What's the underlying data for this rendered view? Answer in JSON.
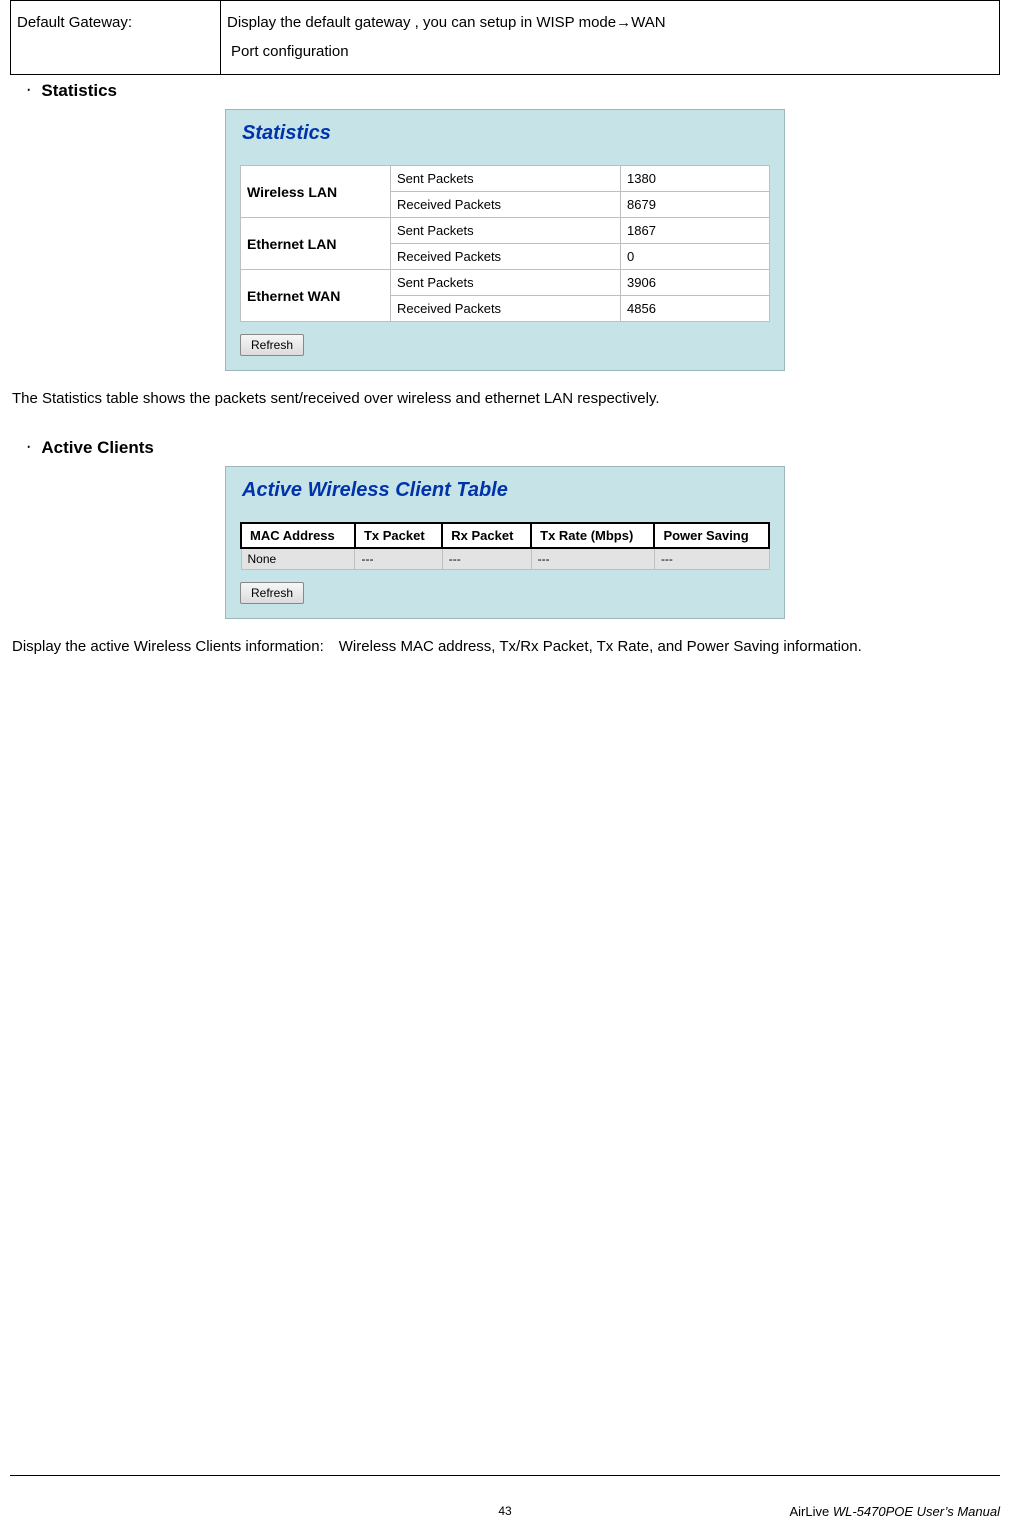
{
  "info_table": {
    "label": "Default Gateway:",
    "desc_line1": "Display the default gateway , you can setup in WISP mode→WAN",
    "desc_line2": "Port configuration"
  },
  "sections": {
    "statistics": {
      "bullet": "‧",
      "title": "Statistics",
      "panel_title": "Statistics",
      "rows": [
        {
          "iface": "Wireless LAN",
          "metric": "Sent Packets",
          "value": "1380"
        },
        {
          "iface": "",
          "metric": "Received Packets",
          "value": "8679"
        },
        {
          "iface": "Ethernet LAN",
          "metric": "Sent Packets",
          "value": "1867"
        },
        {
          "iface": "",
          "metric": "Received Packets",
          "value": "0"
        },
        {
          "iface": "Ethernet WAN",
          "metric": "Sent Packets",
          "value": "3906"
        },
        {
          "iface": "",
          "metric": "Received Packets",
          "value": "4856"
        }
      ],
      "refresh": "Refresh",
      "body": "The Statistics table shows the packets sent/received over wireless and ethernet LAN respectively."
    },
    "active_clients": {
      "bullet": "‧",
      "title": "Active Clients",
      "panel_title": "Active Wireless Client Table",
      "headers": [
        "MAC Address",
        "Tx Packet",
        "Rx Packet",
        "Tx Rate (Mbps)",
        "Power Saving"
      ],
      "row": [
        "None",
        "---",
        "---",
        "---",
        "---"
      ],
      "refresh": "Refresh",
      "body": "Display the active Wireless Clients information: Wireless MAC address, Tx/Rx Packet, Tx Rate, and Power Saving information."
    }
  },
  "footer": {
    "page": "43",
    "manual_prefix": "AirLive ",
    "manual_italic": "WL-5470POE User’s Manual"
  }
}
